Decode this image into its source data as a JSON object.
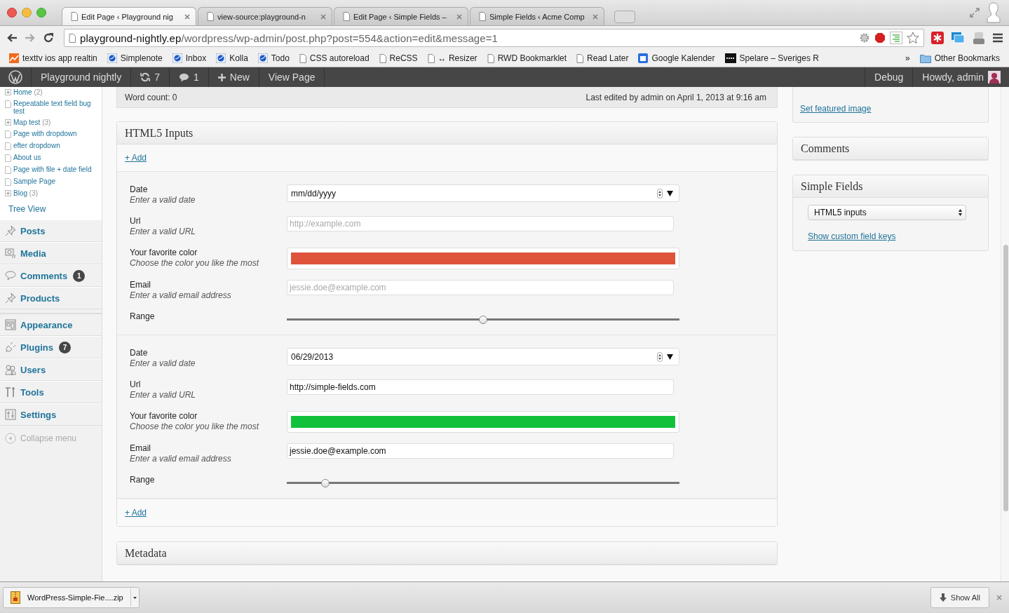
{
  "browser": {
    "tabs": [
      {
        "title": "Edit Page ‹ Playground nig",
        "selected": true
      },
      {
        "title": "view-source:playground-n",
        "selected": false
      },
      {
        "title": "Edit Page ‹ Simple Fields –",
        "selected": false
      },
      {
        "title": "Simple Fields ‹ Acme Comp",
        "selected": false
      }
    ],
    "address": {
      "host": "playground-nightly.ep",
      "path": "/wordpress/wp-admin/post.php?post=554&action=edit&message=1"
    },
    "bookmarks": [
      {
        "label": "texttv ios app realtin",
        "kind": "chart"
      },
      {
        "label": "Simplenote",
        "kind": "app"
      },
      {
        "label": "Inbox",
        "kind": "app"
      },
      {
        "label": "Kolla",
        "kind": "app"
      },
      {
        "label": "Todo",
        "kind": "app"
      },
      {
        "label": "CSS autoreload",
        "kind": "page"
      },
      {
        "label": "ReCSS",
        "kind": "page"
      },
      {
        "label": "↔ Resizer",
        "kind": "page"
      },
      {
        "label": "RWD Bookmarklet",
        "kind": "page"
      },
      {
        "label": "Read Later",
        "kind": "page"
      },
      {
        "label": "Google Kalender",
        "kind": "calendar"
      },
      {
        "label": "Spelare – Sveriges R",
        "kind": "dark"
      }
    ],
    "more": "»",
    "other_bookmarks": "Other Bookmarks"
  },
  "admin_bar": {
    "site": "Playground nightly",
    "updates": "7",
    "comments": "1",
    "new": "New",
    "view": "View Page",
    "debug": "Debug",
    "howdy": "Howdy, admin"
  },
  "page_tree": [
    {
      "label": "Home",
      "count": "(2)",
      "expandable": true
    },
    {
      "label": "Repeatable text field bug test",
      "expandable": false
    },
    {
      "label": "Map test",
      "count": "(3)",
      "expandable": true
    },
    {
      "label": "Page with dropdown",
      "expandable": false
    },
    {
      "label": "efter dropdown",
      "expandable": false
    },
    {
      "label": "About us",
      "expandable": false
    },
    {
      "label": "Page with file + date field",
      "expandable": false
    },
    {
      "label": "Sample Page",
      "expandable": false
    },
    {
      "label": "Blog",
      "count": "(3)",
      "expandable": true
    }
  ],
  "tree_view": "Tree View",
  "menu": [
    {
      "label": "Posts",
      "kind": "pin",
      "separator": false
    },
    {
      "label": "Media",
      "kind": "media",
      "separator": false
    },
    {
      "label": "Comments",
      "kind": "bubble",
      "badge": "1",
      "separator": false
    },
    {
      "label": "Products",
      "kind": "pin",
      "separator": false
    },
    {
      "label": "Appearance",
      "kind": "appearance",
      "separator": true
    },
    {
      "label": "Plugins",
      "kind": "plug",
      "badge": "7",
      "separator": false
    },
    {
      "label": "Users",
      "kind": "users",
      "separator": false
    },
    {
      "label": "Tools",
      "kind": "tools",
      "separator": false
    },
    {
      "label": "Settings",
      "kind": "settings",
      "separator": false
    }
  ],
  "collapse": "Collapse menu",
  "editor_status": {
    "word_count": "Word count: 0",
    "last_edited": "Last edited by admin on April 1, 2013 at 9:16 am"
  },
  "html5_box": {
    "title": "HTML5 Inputs",
    "add_top": "+ Add",
    "add_bottom": "+ Add",
    "groups": [
      {
        "fields": [
          {
            "kind": "date",
            "label": "Date",
            "description": "Enter a valid date",
            "value": "mm/dd/yyyy"
          },
          {
            "kind": "text",
            "label": "Url",
            "description": "Enter a valid URL",
            "placeholder": "http://example.com"
          },
          {
            "kind": "color",
            "label": "Your favorite color",
            "description": "Choose the color you like the most",
            "color": "#e0533b"
          },
          {
            "kind": "text",
            "label": "Email",
            "description": "Enter a valid email address",
            "placeholder": "jessie.doe@example.com"
          },
          {
            "kind": "range",
            "label": "Range",
            "level": 0.5
          }
        ]
      },
      {
        "fields": [
          {
            "kind": "date",
            "label": "Date",
            "description": "Enter a valid date",
            "value": "06/29/2013"
          },
          {
            "kind": "text",
            "label": "Url",
            "description": "Enter a valid URL",
            "value": "http://simple-fields.com"
          },
          {
            "kind": "color",
            "label": "Your favorite color",
            "description": "Choose the color you like the most",
            "color": "#12c13a"
          },
          {
            "kind": "text",
            "label": "Email",
            "description": "Enter a valid email address",
            "value": "jessie.doe@example.com"
          },
          {
            "kind": "range",
            "label": "Range",
            "level": 0.09
          }
        ]
      }
    ]
  },
  "metadata_box": {
    "title": "Metadata"
  },
  "featured_box": {
    "link": "Set featured image"
  },
  "comments_box": {
    "title": "Comments"
  },
  "simple_fields_box": {
    "title": "Simple Fields",
    "select": "HTML5 inputs",
    "link": "Show custom field keys"
  },
  "download_bar": {
    "file": "WordPress-Simple-Fie....zip",
    "show_all": "Show All"
  }
}
